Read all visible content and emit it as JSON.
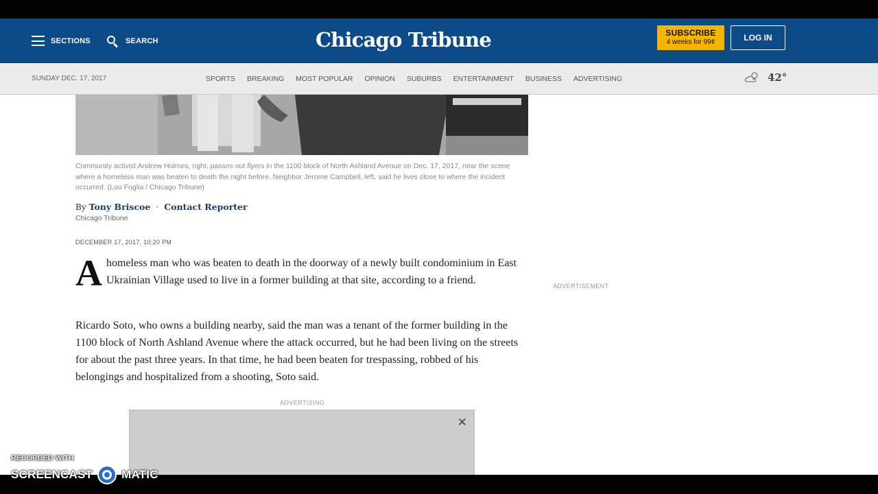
{
  "header": {
    "sections_label": "SECTIONS",
    "search_label": "SEARCH",
    "logo_text": "Chicago Tribune",
    "subscribe_label": "SUBSCRIBE",
    "subscribe_offer": "4 weeks for 99¢",
    "login_label": "LOG IN",
    "brand_color": "#0c4a88",
    "subscribe_color": "#f5b400"
  },
  "navbar": {
    "date": "SUNDAY DEC. 17, 2017",
    "links": [
      "SPORTS",
      "BREAKING",
      "MOST POPULAR",
      "OPINION",
      "SUBURBS",
      "ENTERTAINMENT",
      "BUSINESS",
      "ADVERTISING"
    ],
    "weather_icon": "cloud-sun-icon",
    "temperature": "42°"
  },
  "article": {
    "caption": "Community activist Andrew Holmes, right, passes out flyers in the 1100 block of North Ashland Avenue on Dec. 17, 2017, near the scene where a homeless man was beaten to death the night before. Neighbor Jerome Campbell, left, said he lives close to where the incident occurred. (Lou Foglia / Chicago Tribune)",
    "byline_prefix": "By",
    "author": "Tony Briscoe",
    "byline_separator": "·",
    "contact_label": "Contact Reporter",
    "source": "Chicago Tribune",
    "dateline": "DECEMBER 17, 2017, 10:20 PM",
    "dropcap": "A",
    "paragraph1": "homeless man who was beaten to death in the doorway of a newly built condominium in East Ukrainian Village used to live in a former building at that site, according to a friend.",
    "paragraph2": "Ricardo Soto, who owns a building nearby, said the man was a tenant of the former building in the 1100 block of North Ashland Avenue where the attack occurred, but he had been living on the streets for about the past three years. In that time, he had been beaten for trespassing, robbed of his belongings and hospitalized from a shooting, Soto said."
  },
  "ads": {
    "main_label": "ADVERTISING",
    "side_label": "ADVERTISEMENT",
    "close_glyph": "✕"
  },
  "watermark": {
    "line1": "RECORDED WITH",
    "word1": "SCREENCAST",
    "word2": "MATIC"
  }
}
